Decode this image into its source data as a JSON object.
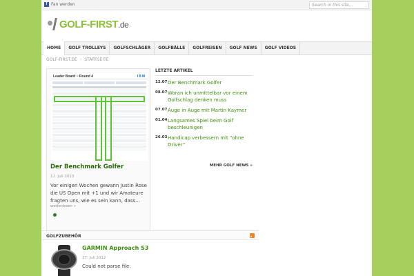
{
  "topbar": {
    "fb_label": "Fan werden",
    "search_placeholder": "Search in this site..."
  },
  "logo": {
    "main": "GOLF-FIRST",
    "tld": ".de"
  },
  "nav": {
    "items": [
      "HOME",
      "GOLF TROLLEYS",
      "GOLFSCHLÄGER",
      "GOLFBÄLLE",
      "GOLFREISEN",
      "GOLF NEWS",
      "GOLF VIDEOS"
    ],
    "active_index": 0
  },
  "breadcrumbs": [
    "GOLF-FIRST.DE",
    "STARTSEITE"
  ],
  "feature": {
    "image": {
      "title": "Leader Board ~ Round 4",
      "brand": "IBM"
    },
    "title": "Der Benchmark Golfer",
    "date": "12. Juli 2013",
    "excerpt": "Vor einigen Wochen gewann Justin Rose die US Open mit +1 und wir Amateure fragten uns, wie es sein kann, dass...",
    "read_more": "weiterlesen »"
  },
  "latest": {
    "heading": "LETZTE ARTIKEL",
    "items": [
      {
        "date": "12.07",
        "title": "Der Benchmark Golfer"
      },
      {
        "date": "08.07",
        "title": "Woran ich unmittelbar vor einem Golfschlag denken muss"
      },
      {
        "date": "07.07",
        "title": "Auge in Auge mit Martin Kaymer"
      },
      {
        "date": "01.04",
        "title": "Langsames Spiel beim Golf beschleunigen"
      },
      {
        "date": "26.03",
        "title": "Handicap verbessern mit “ohne Driver”"
      }
    ],
    "more": "MEHR GOLF NEWS »"
  },
  "section": {
    "title": "GOLFZUBEHÖR"
  },
  "product": {
    "title": "GARMIN Approach S3",
    "date": "27. Juli 2012",
    "text": "Could not parse file."
  },
  "colors": {
    "background": "#a6cf5e",
    "link_green": "#3e8e0f",
    "frame_green": "#5ec433",
    "facebook": "#3b5998",
    "rss": "#f58220"
  }
}
